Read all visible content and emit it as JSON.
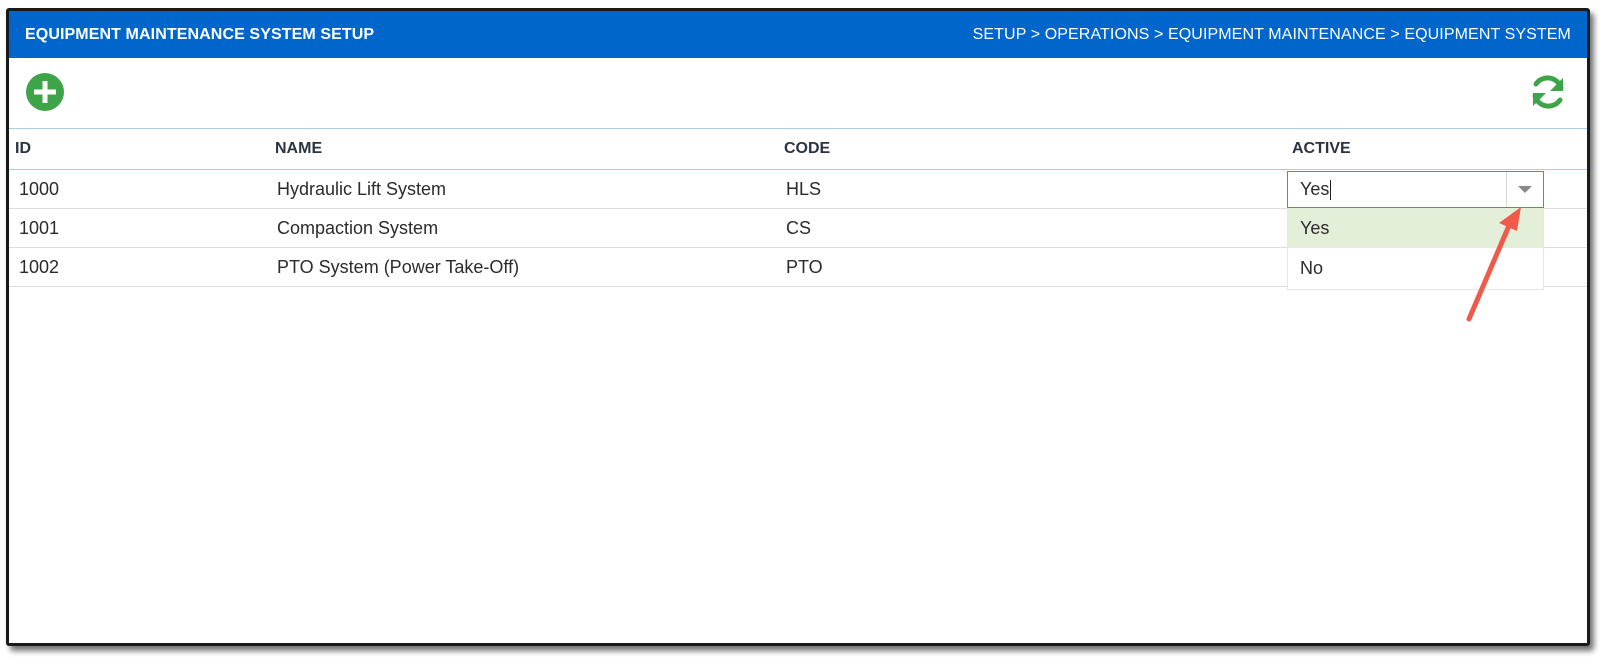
{
  "header": {
    "title": "EQUIPMENT MAINTENANCE SYSTEM SETUP",
    "breadcrumb": "SETUP > OPERATIONS > EQUIPMENT MAINTENANCE > EQUIPMENT SYSTEM",
    "background_color": "#0066cc"
  },
  "toolbar": {
    "add_icon": "add-circle-icon",
    "refresh_icon": "refresh-icon",
    "icon_color": "#3da548"
  },
  "grid": {
    "columns": [
      "ID",
      "NAME",
      "CODE",
      "ACTIVE"
    ],
    "rows": [
      {
        "id": "1000",
        "name": "Hydraulic Lift System",
        "code": "HLS"
      },
      {
        "id": "1001",
        "name": "Compaction System",
        "code": "CS"
      },
      {
        "id": "1002",
        "name": "PTO System (Power Take-Off)",
        "code": "PTO"
      }
    ]
  },
  "active_editor": {
    "value": "Yes",
    "options": [
      "Yes",
      "No"
    ],
    "selected_option": "Yes",
    "highlight_color": "#e3efd9"
  },
  "annotation": {
    "arrow_color": "#f05a4a"
  }
}
